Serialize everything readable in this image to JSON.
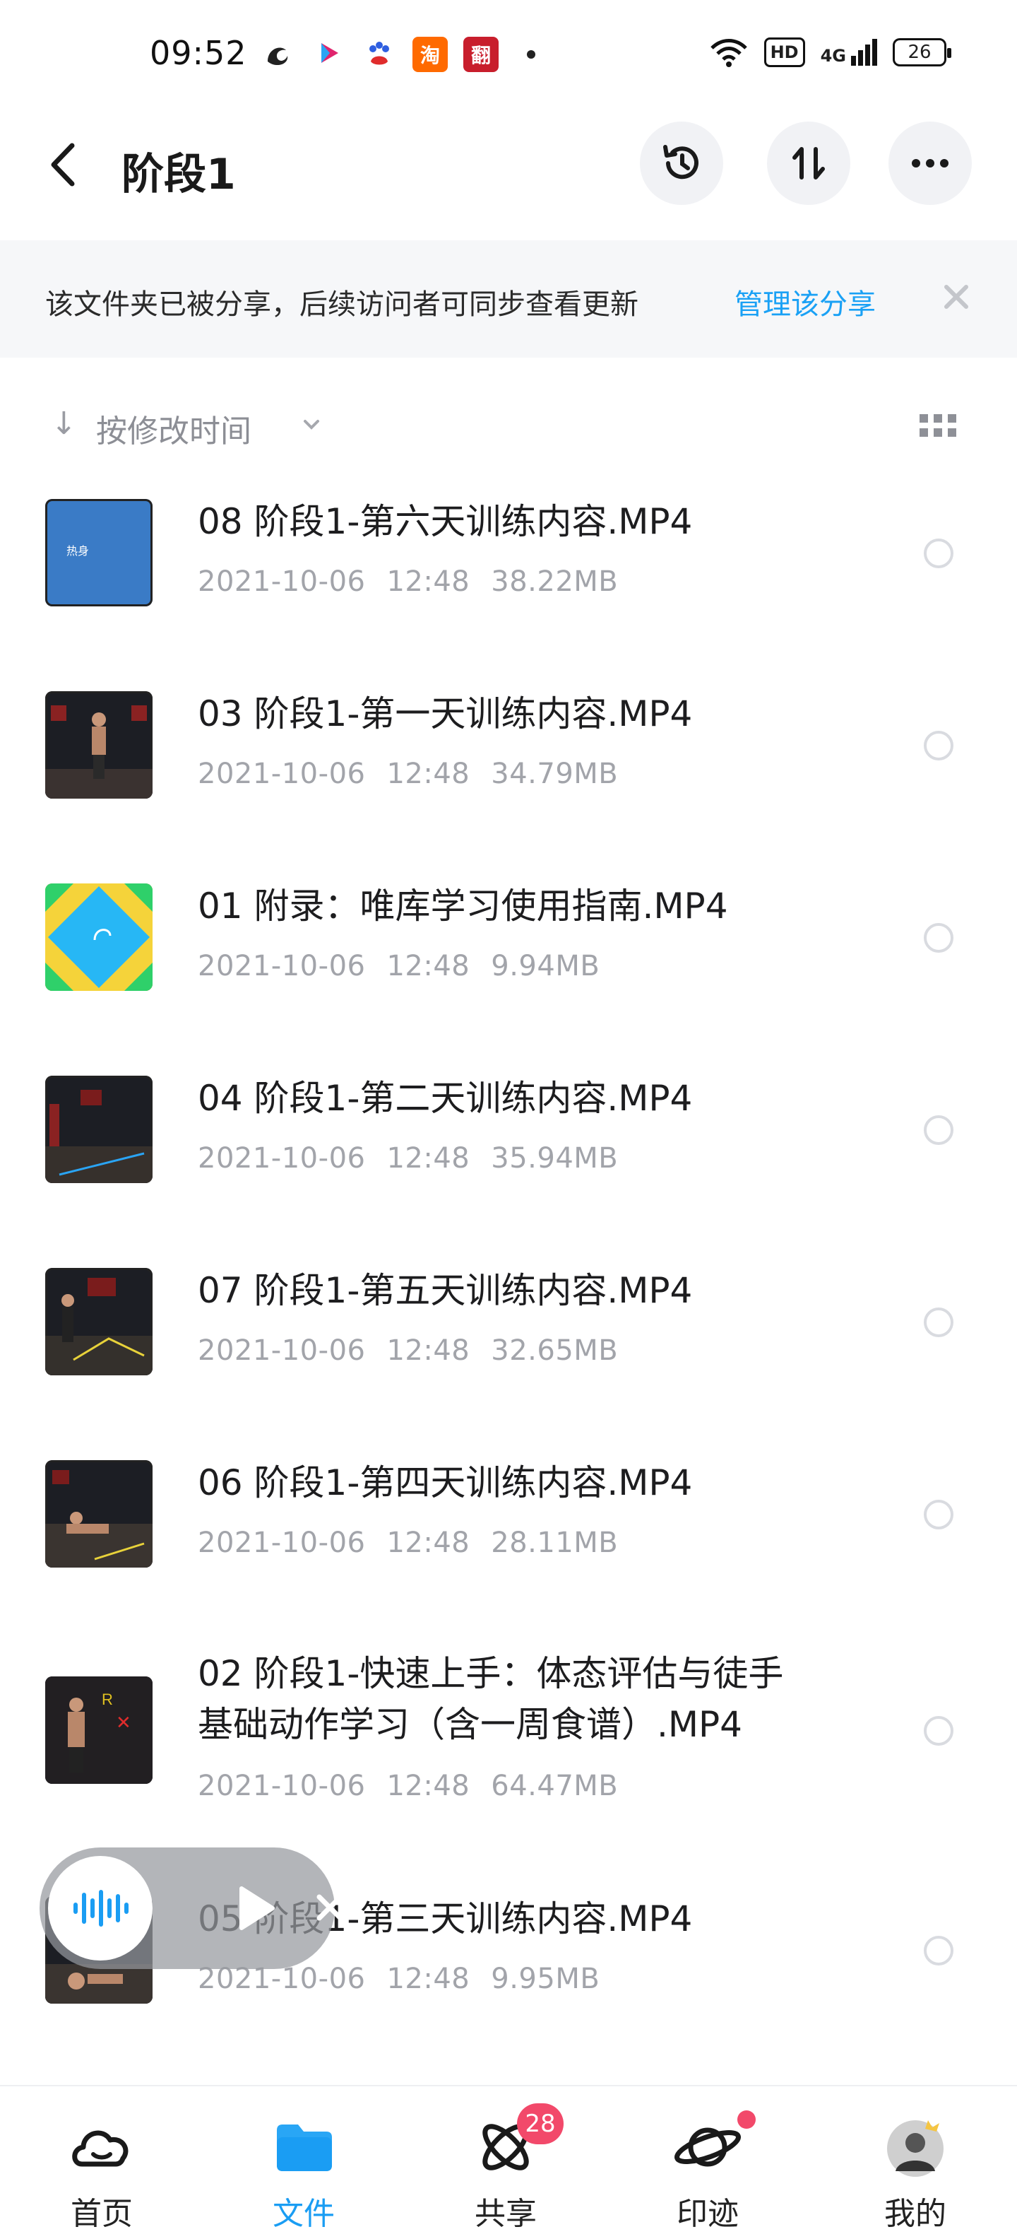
{
  "status_bar": {
    "time": "09:52",
    "apps": [
      {
        "name": "uc-browser-icon",
        "glyph": "🐿",
        "color": "#ffffff"
      },
      {
        "name": "youku-icon",
        "glyph": "▶",
        "color": "#ffffff"
      },
      {
        "name": "baidu-icon",
        "glyph": "🐾",
        "color": "#ffffff"
      },
      {
        "name": "taobao-icon",
        "glyph": "淘",
        "color": "#ff6a00"
      },
      {
        "name": "fanyi-icon",
        "glyph": "翻",
        "color": "#c81e2c"
      }
    ],
    "hd": "HD",
    "network": "4G",
    "battery": "26"
  },
  "header": {
    "title": "阶段1"
  },
  "share_banner": {
    "text": "该文件夹已被分享，后续访问者可同步查看更新",
    "link": "管理该分享"
  },
  "sort": {
    "label": "按修改时间"
  },
  "files": [
    {
      "name": "08 阶段1-第六天训练内容.MP4",
      "date": "2021-10-06",
      "time": "12:48",
      "size": "38.22MB",
      "thumb": "blue",
      "thumb_text": "热身"
    },
    {
      "name": "03 阶段1-第一天训练内容.MP4",
      "date": "2021-10-06",
      "time": "12:48",
      "size": "34.79MB",
      "thumb": "dark"
    },
    {
      "name": "01 附录：唯库学习使用指南.MP4",
      "date": "2021-10-06",
      "time": "12:48",
      "size": "9.94MB",
      "thumb": "green"
    },
    {
      "name": "04 阶段1-第二天训练内容.MP4",
      "date": "2021-10-06",
      "time": "12:48",
      "size": "35.94MB",
      "thumb": "dark"
    },
    {
      "name": "07 阶段1-第五天训练内容.MP4",
      "date": "2021-10-06",
      "time": "12:48",
      "size": "32.65MB",
      "thumb": "dark"
    },
    {
      "name": "06 阶段1-第四天训练内容.MP4",
      "date": "2021-10-06",
      "time": "12:48",
      "size": "28.11MB",
      "thumb": "dark"
    },
    {
      "name_line1": "02 阶段1-快速上手：体态评估与徒手",
      "name_line2": "基础动作学习（含一周食谱）.MP4",
      "date": "2021-10-06",
      "time": "12:48",
      "size": "64.47MB",
      "thumb": "dark"
    },
    {
      "name": "05 阶段1-第三天训练内容.MP4",
      "date": "2021-10-06",
      "time": "12:48",
      "size": "9.95MB",
      "thumb": "dark"
    }
  ],
  "bottom_nav": [
    {
      "label": "首页",
      "icon": "cloud-icon"
    },
    {
      "label": "文件",
      "icon": "folder-icon",
      "active": true
    },
    {
      "label": "共享",
      "icon": "atom-icon",
      "badge": "28"
    },
    {
      "label": "印迹",
      "icon": "planet-icon",
      "dot": true
    },
    {
      "label": "我的",
      "icon": "avatar"
    }
  ],
  "colors": {
    "accent": "#1a9df3",
    "badge": "#f2496a",
    "banner_bg": "#f6f7f9"
  }
}
